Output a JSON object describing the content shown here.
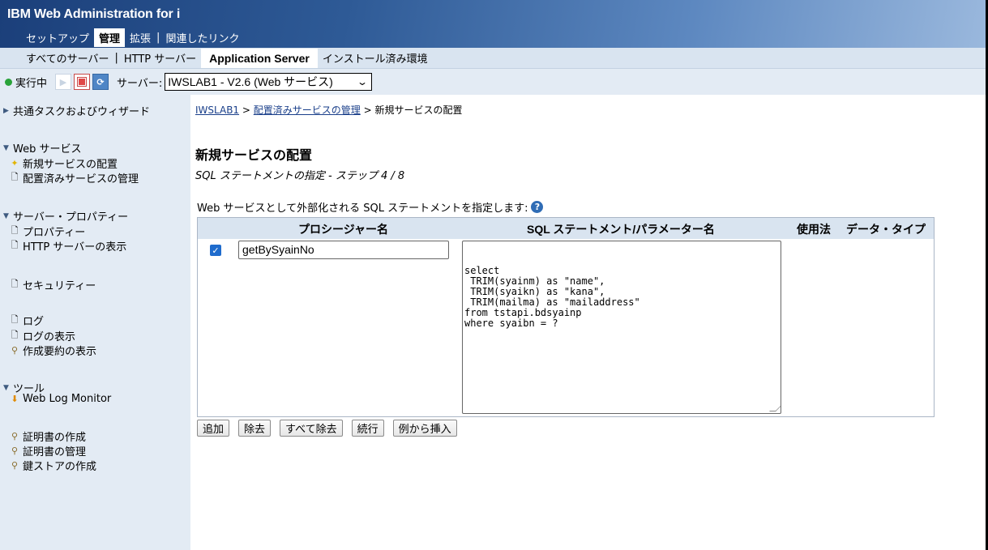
{
  "header": {
    "brand": "IBM Web Administration for i",
    "topnav": [
      "セットアップ",
      "管理",
      "拡張",
      "関連したリンク"
    ],
    "topnav_active": "管理"
  },
  "subnav": {
    "items": [
      "すべてのサーバー",
      "HTTP サーバー",
      "Application Server",
      "インストール済み環境"
    ]
  },
  "statusbar": {
    "state": "実行中",
    "server_label": "サーバー:",
    "server_value": "IWSLAB1 - V2.6 (Web サービス)"
  },
  "sidebar": {
    "common_tasks": "共通タスクおよびウィザード",
    "web_services": "Web サービス",
    "deploy_new": "新規サービスの配置",
    "manage_deployed": "配置済みサービスの管理",
    "server_props": "サーバー・プロパティー",
    "properties": "プロパティー",
    "http_view": "HTTP サーバーの表示",
    "security": "セキュリティー",
    "logs": "ログ",
    "log_view": "ログの表示",
    "summary_view": "作成要約の表示",
    "tools": "ツール",
    "web_log_monitor": "Web Log Monitor",
    "cert_create": "証明書の作成",
    "cert_manage": "証明書の管理",
    "keystore_create": "鍵ストアの作成"
  },
  "breadcrumb": {
    "link1": "IWSLAB1",
    "sep": " > ",
    "link2": "配置済みサービスの管理",
    "current": "新規サービスの配置"
  },
  "page": {
    "title": "新規サービスの配置",
    "subtitle": "SQL ステートメントの指定 - ステップ 4 / 8",
    "intro": "Web サービスとして外部化される SQL ステートメントを指定します:"
  },
  "table": {
    "headers": {
      "procedure": "プロシージャー名",
      "sql": "SQL ステートメント/パラメーター名",
      "usage": "使用法",
      "datatype": "データ・タイプ"
    },
    "row": {
      "checked": true,
      "procedure_name": "getBySyainNo",
      "sql": "select\n TRIM(syainm) as \"name\",\n TRIM(syaikn) as \"kana\",\n TRIM(mailma) as \"mailaddress\"\nfrom tstapi.bdsyainp\nwhere syaibn = ?"
    }
  },
  "buttons": {
    "add": "追加",
    "remove": "除去",
    "remove_all": "すべて除去",
    "continue": "続行",
    "insert_example": "例から挿入"
  },
  "colors": {
    "header_dark": "#1b3f7a",
    "subnav_bg": "#d9e4f0",
    "sidebar_bg": "#e3ebf4",
    "link": "#1a3f8a",
    "running_dot": "#2aa33a"
  }
}
